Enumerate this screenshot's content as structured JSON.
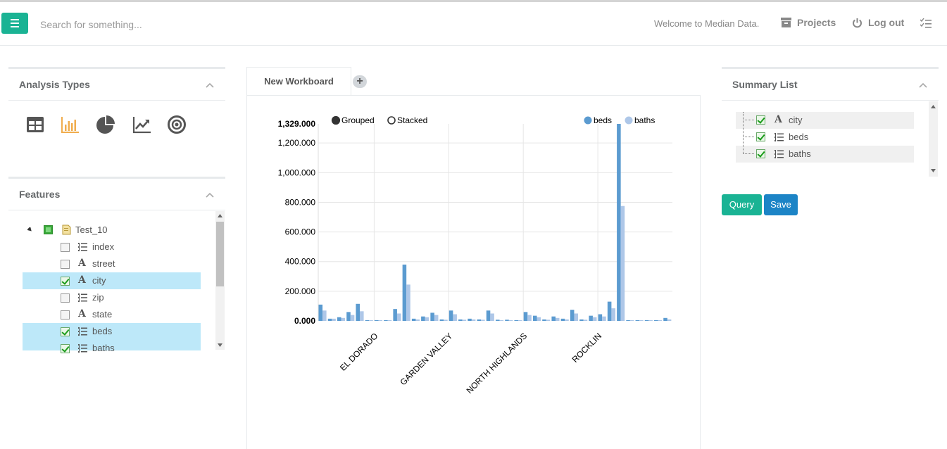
{
  "header": {
    "search_placeholder": "Search for something...",
    "welcome": "Welcome to Median Data.",
    "projects_label": "Projects",
    "logout_label": "Log out"
  },
  "analysis_types": {
    "title": "Analysis Types",
    "items": [
      {
        "icon": "table-icon",
        "active": false
      },
      {
        "icon": "bar-chart-icon",
        "active": true
      },
      {
        "icon": "pie-chart-icon",
        "active": false
      },
      {
        "icon": "line-chart-icon",
        "active": false
      },
      {
        "icon": "target-icon",
        "active": false
      }
    ]
  },
  "features": {
    "title": "Features",
    "root": "Test_10",
    "items": [
      {
        "label": "index",
        "type": "list",
        "checked": false,
        "selected": false
      },
      {
        "label": "street",
        "type": "text",
        "checked": false,
        "selected": false
      },
      {
        "label": "city",
        "type": "text",
        "checked": true,
        "selected": true
      },
      {
        "label": "zip",
        "type": "list",
        "checked": false,
        "selected": false
      },
      {
        "label": "state",
        "type": "text",
        "checked": false,
        "selected": false
      },
      {
        "label": "beds",
        "type": "list",
        "checked": true,
        "selected": true
      },
      {
        "label": "baths",
        "type": "list",
        "checked": true,
        "selected": true
      }
    ]
  },
  "workboard": {
    "tab_label": "New Workboard",
    "add_label": "+"
  },
  "summary": {
    "title": "Summary List",
    "items": [
      {
        "label": "city",
        "type": "text"
      },
      {
        "label": "beds",
        "type": "list"
      },
      {
        "label": "baths",
        "type": "list"
      }
    ],
    "query_label": "Query",
    "save_label": "Save"
  },
  "colors": {
    "accent": "#1ab394",
    "primary": "#1c84c6",
    "beds": "#5b9bd0",
    "baths": "#aec7e8",
    "active_icon": "#f0ad4e"
  },
  "chart_data": {
    "type": "bar",
    "mode_options": [
      "Grouped",
      "Stacked"
    ],
    "mode_selected": "Grouped",
    "legend_placement": "top-right",
    "series": [
      {
        "name": "beds",
        "values": [
          110,
          15,
          25,
          60,
          115,
          5,
          5,
          5,
          80,
          380,
          15,
          30,
          55,
          10,
          70,
          10,
          15,
          10,
          70,
          8,
          8,
          5,
          60,
          35,
          10,
          30,
          15,
          75,
          10,
          35,
          45,
          130,
          1329,
          5,
          5,
          5,
          5,
          20
        ]
      },
      {
        "name": "baths",
        "values": [
          70,
          15,
          20,
          40,
          65,
          5,
          5,
          5,
          50,
          245,
          10,
          25,
          40,
          8,
          45,
          8,
          10,
          8,
          50,
          5,
          5,
          5,
          40,
          25,
          8,
          20,
          10,
          50,
          8,
          25,
          30,
          85,
          775,
          5,
          5,
          5,
          5,
          10
        ]
      }
    ],
    "x_tick_labels": [
      "EL DORADO",
      "GARDEN VALLEY",
      "NORTH HIGHLANDS",
      "ROCKLIN"
    ],
    "x_tick_positions": [
      6,
      14,
      22,
      30
    ],
    "y_ticks": [
      "0.000",
      "200.000",
      "400.000",
      "600.000",
      "800.000",
      "1,000.000",
      "1,200.000",
      "1,329.000"
    ],
    "y_tick_values": [
      0,
      200,
      400,
      600,
      800,
      1000,
      1200,
      1329
    ],
    "ylim": [
      0,
      1329
    ],
    "grid": true
  }
}
